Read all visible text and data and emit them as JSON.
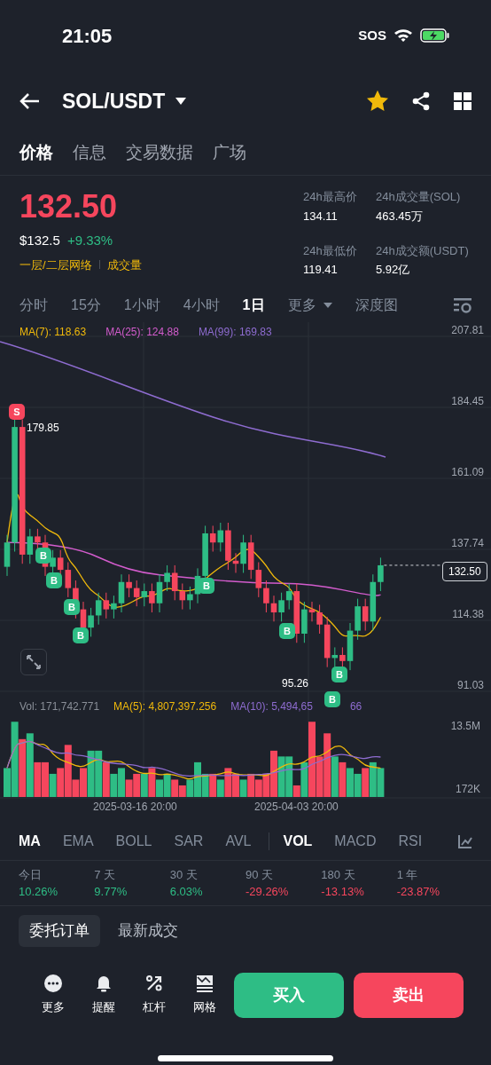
{
  "status_bar": {
    "time": "21:05",
    "sos": "SOS"
  },
  "header": {
    "pair": "SOL/USDT",
    "favorite": true
  },
  "tabs": [
    {
      "label": "价格",
      "selected": true
    },
    {
      "label": "信息",
      "selected": false
    },
    {
      "label": "交易数据",
      "selected": false
    },
    {
      "label": "广场",
      "selected": false
    }
  ],
  "price": {
    "last": "132.50",
    "usd": "$132.5",
    "change": "+9.33%",
    "tags": [
      "一层/二层网络",
      "成交量"
    ]
  },
  "stats": [
    {
      "label": "24h最高价",
      "value": "134.11"
    },
    {
      "label": "24h成交量(SOL)",
      "value": "463.45万"
    },
    {
      "label": "24h最低价",
      "value": "119.41"
    },
    {
      "label": "24h成交额(USDT)",
      "value": "5.92亿"
    }
  ],
  "intervals": [
    {
      "label": "分时",
      "selected": false,
      "kind": "option"
    },
    {
      "label": "15分",
      "selected": false,
      "kind": "option"
    },
    {
      "label": "1小时",
      "selected": false,
      "kind": "option"
    },
    {
      "label": "4小时",
      "selected": false,
      "kind": "option"
    },
    {
      "label": "1日",
      "selected": true,
      "kind": "option"
    },
    {
      "label": "更多",
      "selected": false,
      "kind": "menu"
    },
    {
      "label": "深度图",
      "selected": false,
      "kind": "option"
    }
  ],
  "chart": {
    "ma_legend": [
      {
        "label": "MA(7): 118.63",
        "color": "#f0b90b"
      },
      {
        "label": "MA(25): 124.88",
        "color": "#d35ccd"
      },
      {
        "label": "MA(99): 169.83",
        "color": "#8e6cd0"
      }
    ],
    "y_labels": [
      "207.81",
      "184.45",
      "161.09",
      "137.74",
      "114.38",
      "91.03"
    ],
    "high_label": "179.85",
    "low_label": "95.26",
    "current_price": "132.50",
    "trade_markers": [
      "S",
      "B",
      "B",
      "B",
      "B",
      "B",
      "B",
      "B",
      "B"
    ]
  },
  "volume": {
    "legend": [
      {
        "label": "Vol: 171,742.771",
        "color": "#8a8f98"
      },
      {
        "label": "MA(5): 4,807,397.256",
        "color": "#f0b90b"
      },
      {
        "label": "MA(10): 5,494,65",
        "color": "#8e6cd0"
      },
      {
        "label": "66",
        "color": "#8e6cd0"
      }
    ],
    "y_labels": [
      "13.5M",
      "172K"
    ],
    "x_labels": [
      "2025-03-16 20:00",
      "2025-04-03 20:00"
    ]
  },
  "indicators": [
    {
      "label": "MA",
      "selected": true
    },
    {
      "label": "EMA",
      "selected": false
    },
    {
      "label": "BOLL",
      "selected": false
    },
    {
      "label": "SAR",
      "selected": false
    },
    {
      "label": "AVL",
      "selected": false
    },
    {
      "label": "VOL",
      "selected": true
    },
    {
      "label": "MACD",
      "selected": false
    },
    {
      "label": "RSI",
      "selected": false
    }
  ],
  "returns": [
    {
      "period": "今日",
      "value": "10.26%",
      "color": "#2ebd85"
    },
    {
      "period": "7 天",
      "value": "9.77%",
      "color": "#2ebd85"
    },
    {
      "period": "30 天",
      "value": "6.03%",
      "color": "#2ebd85"
    },
    {
      "period": "90 天",
      "value": "-29.26%",
      "color": "#f6465d"
    },
    {
      "period": "180 天",
      "value": "-13.13%",
      "color": "#f6465d"
    },
    {
      "period": "1 年",
      "value": "-23.87%",
      "color": "#f6465d"
    }
  ],
  "order_tabs": [
    {
      "label": "委托订单",
      "selected": true
    },
    {
      "label": "最新成交",
      "selected": false
    }
  ],
  "actions": [
    {
      "label": "更多",
      "kind": "more"
    },
    {
      "label": "提醒",
      "kind": "alert"
    },
    {
      "label": "杠杆",
      "kind": "leverage"
    },
    {
      "label": "网格",
      "kind": "grid"
    }
  ],
  "buy": "买入",
  "sell": "卖出"
}
